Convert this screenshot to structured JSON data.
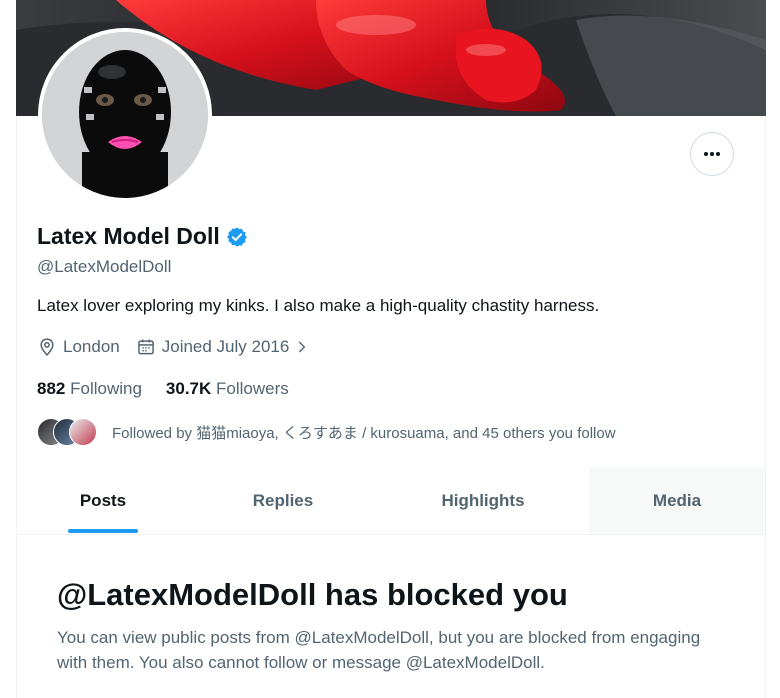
{
  "profile": {
    "display_name": "Latex Model Doll",
    "handle": "@LatexModelDoll",
    "bio": "Latex lover exploring my kinks. I also make a high-quality chastity harness.",
    "location": "London",
    "joined": "Joined July 2016",
    "following_count": "882",
    "following_label": "Following",
    "followers_count": "30.7K",
    "followers_label": "Followers",
    "followed_by": "Followed by 猫猫miaoya, くろすあま / kurosuama, and 45 others you follow",
    "verified_color": "#1d9bf0"
  },
  "tabs": [
    {
      "label": "Posts",
      "active": true
    },
    {
      "label": "Replies",
      "active": false
    },
    {
      "label": "Highlights",
      "active": false
    },
    {
      "label": "Media",
      "active": false
    }
  ],
  "blocked": {
    "title": "@LatexModelDoll has blocked you",
    "body": "You can view public posts from @LatexModelDoll, but you are blocked from engaging with them. You also cannot follow or message @LatexModelDoll."
  },
  "icons": {
    "more": "more-icon",
    "verified": "verified-badge-icon",
    "location": "location-pin-icon",
    "calendar": "calendar-icon",
    "chevron": "chevron-right-icon"
  },
  "colors": {
    "accent": "#1d9bf0",
    "text_primary": "#0f1419",
    "text_secondary": "#536471"
  }
}
